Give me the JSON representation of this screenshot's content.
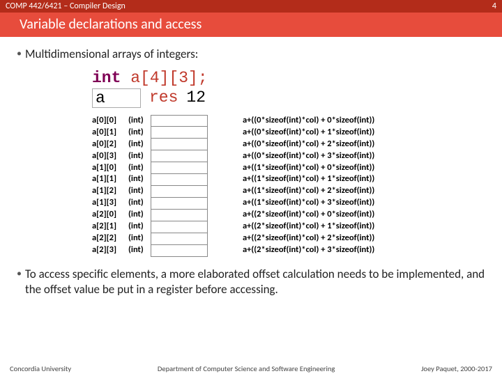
{
  "header": {
    "course": "COMP 442/6421 – Compiler Design",
    "page_number": "4",
    "title": "Variable declarations and access"
  },
  "body": {
    "bullet1": "Multidimensional arrays of integers:",
    "decl_type": "int",
    "decl_rest": " a[4][3];",
    "reserve_label": "a",
    "reserve_instr": "res",
    "reserve_val": "12",
    "bullet2": "To access specific elements, a more elaborated offset calculation needs to be implemented, and the offset value be put in a register before accessing."
  },
  "mem_rows": [
    {
      "idx": "a[0][0]",
      "type": "(int)",
      "addr": "a+((0*sizeof(int)*col) + 0*sizeof(int))"
    },
    {
      "idx": "a[0][1]",
      "type": "(int)",
      "addr": "a+((0*sizeof(int)*col) + 1*sizeof(int))"
    },
    {
      "idx": "a[0][2]",
      "type": "(int)",
      "addr": "a+((0*sizeof(int)*col) + 2*sizeof(int))"
    },
    {
      "idx": "a[0][3]",
      "type": "(int)",
      "addr": "a+((0*sizeof(int)*col) + 3*sizeof(int))"
    },
    {
      "idx": "a[1][0]",
      "type": "(int)",
      "addr": "a+((1*sizeof(int)*col) + 0*sizeof(int))"
    },
    {
      "idx": "a[1][1]",
      "type": "(int)",
      "addr": "a+((1*sizeof(int)*col) + 1*sizeof(int))"
    },
    {
      "idx": "a[1][2]",
      "type": "(int)",
      "addr": "a+((1*sizeof(int)*col) + 2*sizeof(int))"
    },
    {
      "idx": "a[1][3]",
      "type": "(int)",
      "addr": "a+((1*sizeof(int)*col) + 3*sizeof(int))"
    },
    {
      "idx": "a[2][0]",
      "type": "(int)",
      "addr": "a+((2*sizeof(int)*col) + 0*sizeof(int))"
    },
    {
      "idx": "a[2][1]",
      "type": "(int)",
      "addr": "a+((2*sizeof(int)*col) + 1*sizeof(int))"
    },
    {
      "idx": "a[2][2]",
      "type": "(int)",
      "addr": "a+((2*sizeof(int)*col) + 2*sizeof(int))"
    },
    {
      "idx": "a[2][3]",
      "type": "(int)",
      "addr": "a+((2*sizeof(int)*col) + 3*sizeof(int))"
    }
  ],
  "footer": {
    "left": "Concordia University",
    "center": "Department of Computer Science and Software Engineering",
    "right": "Joey Paquet, 2000-2017"
  }
}
